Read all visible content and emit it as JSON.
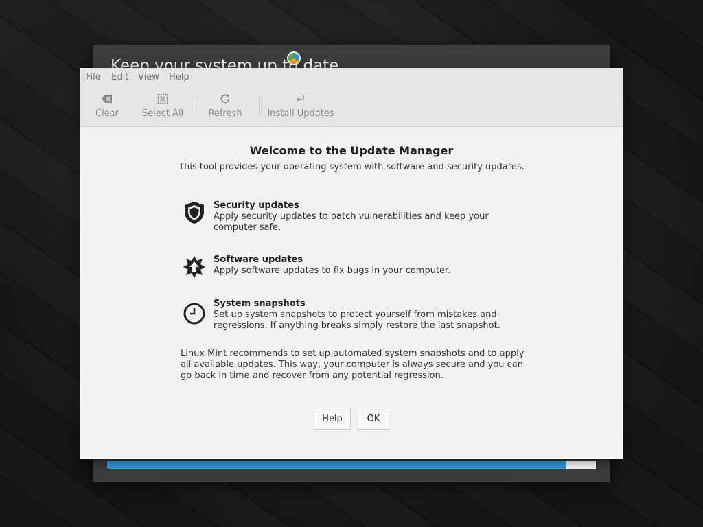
{
  "installer": {
    "title": "Keep your system up to date",
    "progress_percent": 94
  },
  "dialog": {
    "menu": [
      "File",
      "Edit",
      "View",
      "Help"
    ],
    "toolbar": {
      "clear_label": "Clear",
      "select_all_label": "Select All",
      "refresh_label": "Refresh",
      "install_label": "Install Updates"
    },
    "welcome_title": "Welcome to the Update Manager",
    "welcome_subtitle": "This tool provides your operating system with software and security updates.",
    "features": [
      {
        "title": "Security updates",
        "description": "Apply security updates to patch vulnerabilities and keep your computer safe.",
        "icon": "shield-icon"
      },
      {
        "title": "Software updates",
        "description": "Apply software updates to fix bugs in your computer.",
        "icon": "update-star-icon"
      },
      {
        "title": "System snapshots",
        "description": "Set up system snapshots to protect yourself from mistakes and regressions. If anything breaks simply restore the last snapshot.",
        "icon": "clock-icon"
      }
    ],
    "recommendation": "Linux Mint recommends to set up automated system snapshots and to apply all available updates. This way, your computer is always secure and you can go back in time and recover from any potential regression.",
    "buttons": {
      "help": "Help",
      "ok": "OK"
    }
  },
  "colors": {
    "progress_fill": "#2e9ee6",
    "dialog_bg": "#f2f2f2",
    "toolbar_bg": "#e5e5e5"
  }
}
